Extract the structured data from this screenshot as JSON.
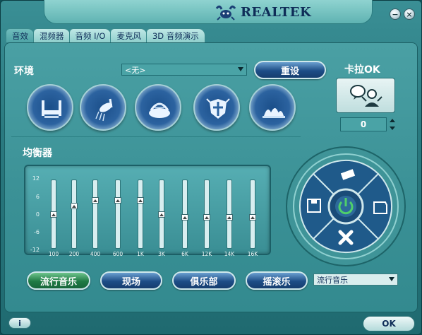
{
  "header": {
    "brand": "REALTEK"
  },
  "window_controls": {
    "minimize": "−",
    "close": "×"
  },
  "tabs": [
    {
      "label": "音效",
      "active": true
    },
    {
      "label": "混频器",
      "active": false
    },
    {
      "label": "音频 I/O",
      "active": false
    },
    {
      "label": "麦克风",
      "active": false
    },
    {
      "label": "3D 音频演示",
      "active": false
    }
  ],
  "environment": {
    "title": "环境",
    "selected": "<无>",
    "reset_label": "重设",
    "icons": [
      "bath-icon",
      "shower-icon",
      "colosseum-icon",
      "knight-shield-icon",
      "opera-house-icon"
    ]
  },
  "karaoke": {
    "title": "卡拉OK",
    "value": "0",
    "icon": "karaoke-singer-icon"
  },
  "equalizer": {
    "title": "均衡器",
    "scale": [
      "12",
      "6",
      "0",
      "-6",
      "-12"
    ],
    "bands": [
      "100",
      "200",
      "400",
      "600",
      "1K",
      "3K",
      "6K",
      "12K",
      "14K",
      "16K"
    ],
    "levels_db": [
      0,
      3,
      5,
      5,
      5,
      0,
      -1,
      -1,
      -1,
      -1
    ],
    "presets": [
      {
        "label": "流行音乐",
        "active": true
      },
      {
        "label": "现场",
        "active": false
      },
      {
        "label": "俱乐部",
        "active": false
      },
      {
        "label": "摇滚乐",
        "active": false
      }
    ],
    "preset_selected": "流行音乐"
  },
  "control_dial": {
    "icons": [
      "eraser-icon",
      "folder-icon",
      "delete-icon",
      "save-icon",
      "power-icon"
    ]
  },
  "footer": {
    "info_label": "i",
    "ok_label": "OK"
  },
  "colors": {
    "accent_teal": "#3a9095",
    "button_blue": "#1d4d86",
    "button_green": "#1f7a45",
    "brand_navy": "#0f2d58"
  }
}
